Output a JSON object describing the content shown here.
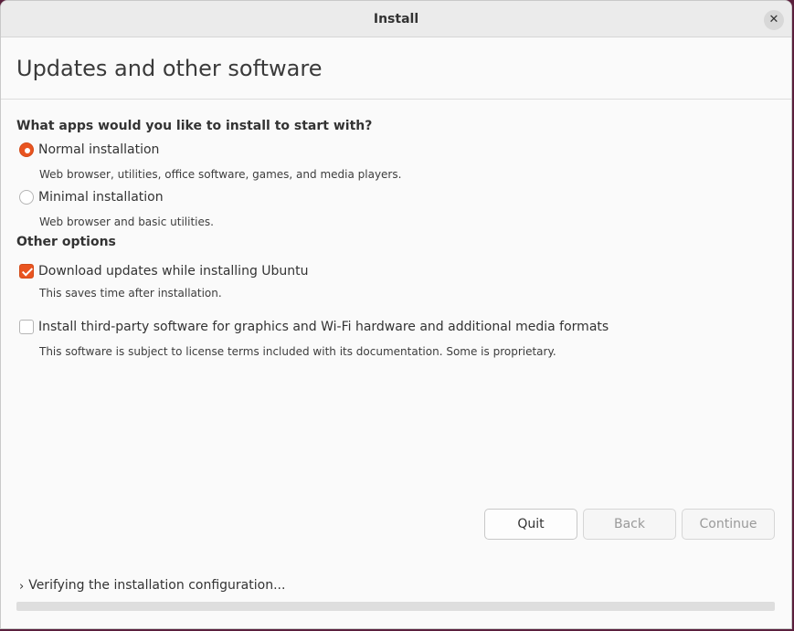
{
  "window": {
    "title": "Install",
    "close_glyph": "✕"
  },
  "page": {
    "title": "Updates and other software"
  },
  "install_type": {
    "heading": "What apps would you like to install to start with?",
    "options": [
      {
        "label": "Normal installation",
        "description": "Web browser, utilities, office software, games, and media players.",
        "selected": true
      },
      {
        "label": "Minimal installation",
        "description": "Web browser and basic utilities.",
        "selected": false
      }
    ]
  },
  "other_options": {
    "heading": "Other options",
    "items": [
      {
        "label": "Download updates while installing Ubuntu",
        "description": "This saves time after installation.",
        "checked": true
      },
      {
        "label": "Install third-party software for graphics and Wi-Fi hardware and additional media formats",
        "description": "This software is subject to license terms included with its documentation. Some is proprietary.",
        "checked": false
      }
    ]
  },
  "buttons": {
    "quit": "Quit",
    "back": "Back",
    "continue": "Continue"
  },
  "status": {
    "chevron": "›",
    "text": "Verifying the installation configuration...",
    "progress": 0
  },
  "colors": {
    "accent": "#e95420",
    "background": "#fafafa"
  }
}
